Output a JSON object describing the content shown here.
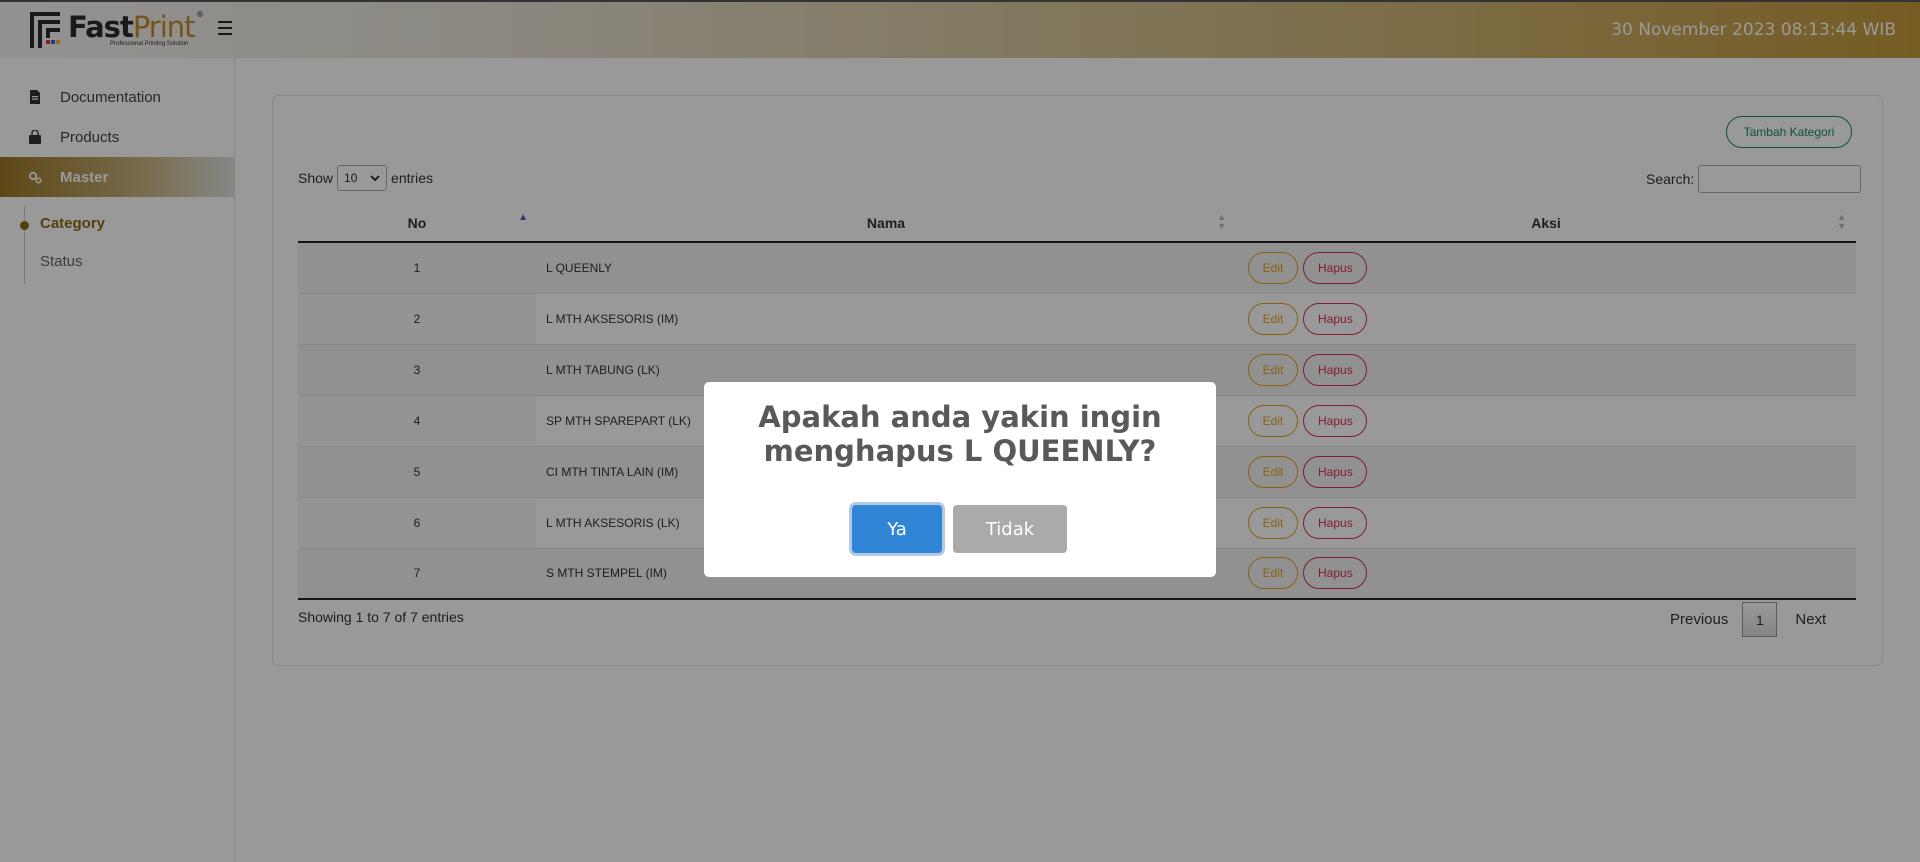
{
  "header": {
    "logo_fast": "Fast",
    "logo_print": "Print",
    "logo_registered": "®",
    "logo_tagline": "Professional Printing Solution",
    "datetime": "30 November 2023 08:13:44 WIB"
  },
  "sidebar": {
    "items": [
      {
        "label": "Documentation",
        "icon": "file-icon"
      },
      {
        "label": "Products",
        "icon": "shopping-bag-icon"
      },
      {
        "label": "Master",
        "icon": "cogs-icon",
        "collapse": "−"
      }
    ],
    "sub_items": [
      {
        "label": "Category",
        "active": true
      },
      {
        "label": "Status",
        "active": false
      }
    ]
  },
  "toolbar": {
    "add_label": "Tambah Kategori",
    "show_label": "Show",
    "entries_value": "10",
    "entries_label": "entries",
    "search_label": "Search:"
  },
  "table": {
    "columns": [
      "No",
      "Nama",
      "Aksi"
    ],
    "rows": [
      {
        "no": "1",
        "nama": "L QUEENLY"
      },
      {
        "no": "2",
        "nama": "L MTH AKSESORIS (IM)"
      },
      {
        "no": "3",
        "nama": "L MTH TABUNG (LK)"
      },
      {
        "no": "4",
        "nama": "SP MTH SPAREPART (LK)"
      },
      {
        "no": "5",
        "nama": "CI MTH TINTA LAIN (IM)"
      },
      {
        "no": "6",
        "nama": "L MTH AKSESORIS (LK)"
      },
      {
        "no": "7",
        "nama": "S MTH STEMPEL (IM)"
      }
    ],
    "edit_label": "Edit",
    "delete_label": "Hapus"
  },
  "footer": {
    "info": "Showing 1 to 7 of 7 entries",
    "previous": "Previous",
    "page": "1",
    "next": "Next"
  },
  "modal": {
    "title": "Apakah anda yakin ingin menghapus L QUEENLY?",
    "confirm": "Ya",
    "cancel": "Tidak"
  },
  "colors": {
    "accent_gold": "#8d6a17",
    "confirm_blue": "#3085d6",
    "cancel_gray": "#aaaaaa",
    "edit_orange": "#e3a41e",
    "delete_red": "#d93050",
    "add_green": "#1e8a5c"
  }
}
